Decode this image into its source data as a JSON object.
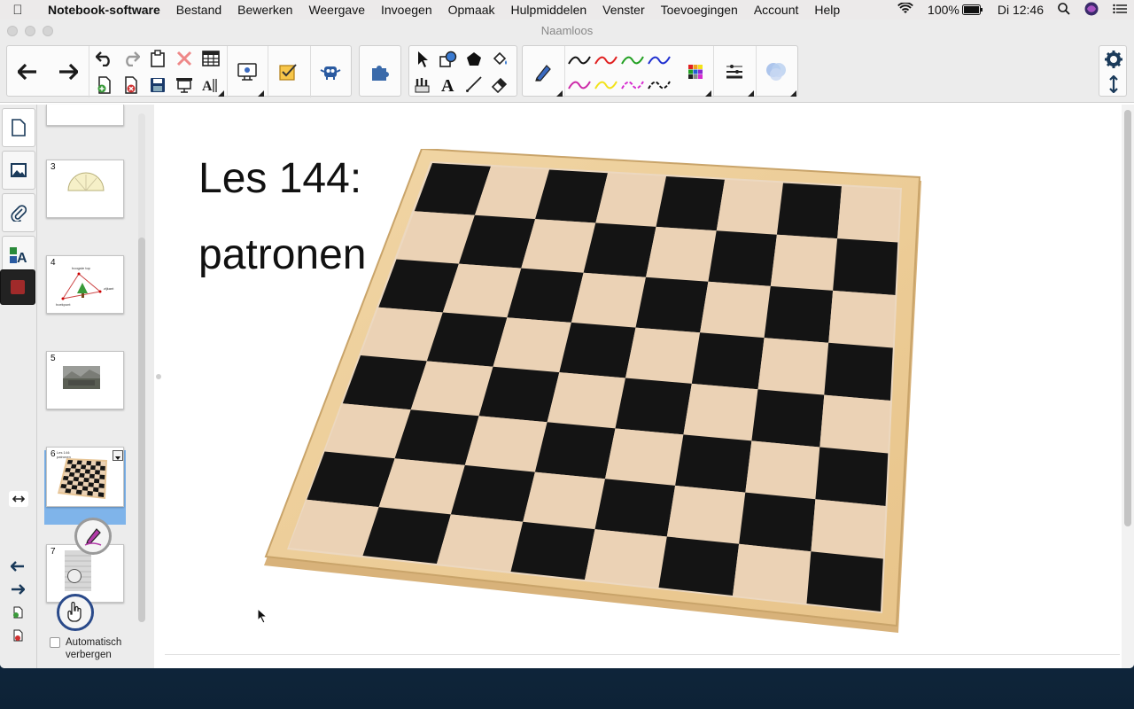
{
  "menubar": {
    "app": "Notebook-software",
    "items": [
      "Bestand",
      "Bewerken",
      "Weergave",
      "Invoegen",
      "Opmaak",
      "Hulpmiddelen",
      "Venster",
      "Toevoegingen",
      "Account",
      "Help"
    ],
    "battery": "100%",
    "clock": "Di 12:46"
  },
  "window": {
    "title": "Naamloos"
  },
  "toolbar": {
    "pen_colors": [
      "#111111",
      "#e02020",
      "#22a022",
      "#2030d0",
      "#cc2aa8",
      "#f2e21a",
      "#d62bd0",
      "#111111"
    ]
  },
  "sorter": {
    "thumbnails": [
      {
        "num": "3"
      },
      {
        "num": "4",
        "labels": [
          "hoogste top",
          "zijkant",
          "hoekpunt"
        ]
      },
      {
        "num": "5"
      },
      {
        "num": "6",
        "labels": [
          "Les 144: patronen"
        ]
      },
      {
        "num": "7"
      }
    ],
    "autohide_label_1": "Automatisch",
    "autohide_label_2": "verbergen"
  },
  "page": {
    "title_line1": "Les 144:",
    "title_line2": "patronen"
  }
}
